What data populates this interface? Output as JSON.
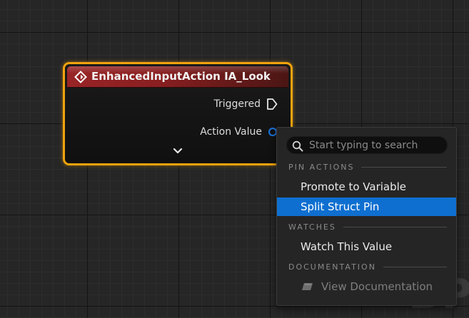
{
  "node": {
    "title": "EnhancedInputAction IA_Look",
    "pins": {
      "triggered": "Triggered",
      "action_value": "Action Value"
    },
    "icons": {
      "event": "event-diamond-icon",
      "exec_pin": "exec-pin-icon",
      "struct_pin": "struct-pin-icon",
      "expand": "chevron-down-icon"
    },
    "colors": {
      "border": "#f0a30e",
      "header": "#982426",
      "struct_pin": "#1d6fd0"
    }
  },
  "context_menu": {
    "search_placeholder": "Start typing to search",
    "sections": {
      "pin_actions": "PIN ACTIONS",
      "watches": "WATCHES",
      "documentation": "DOCUMENTATION"
    },
    "items": {
      "promote": "Promote to Variable",
      "split": "Split Struct Pin",
      "watch": "Watch This Value",
      "view_doc": "View Documentation"
    },
    "selected_item": "Split Struct Pin",
    "colors": {
      "highlight": "#0f6fd0"
    }
  },
  "watermark": "BP"
}
